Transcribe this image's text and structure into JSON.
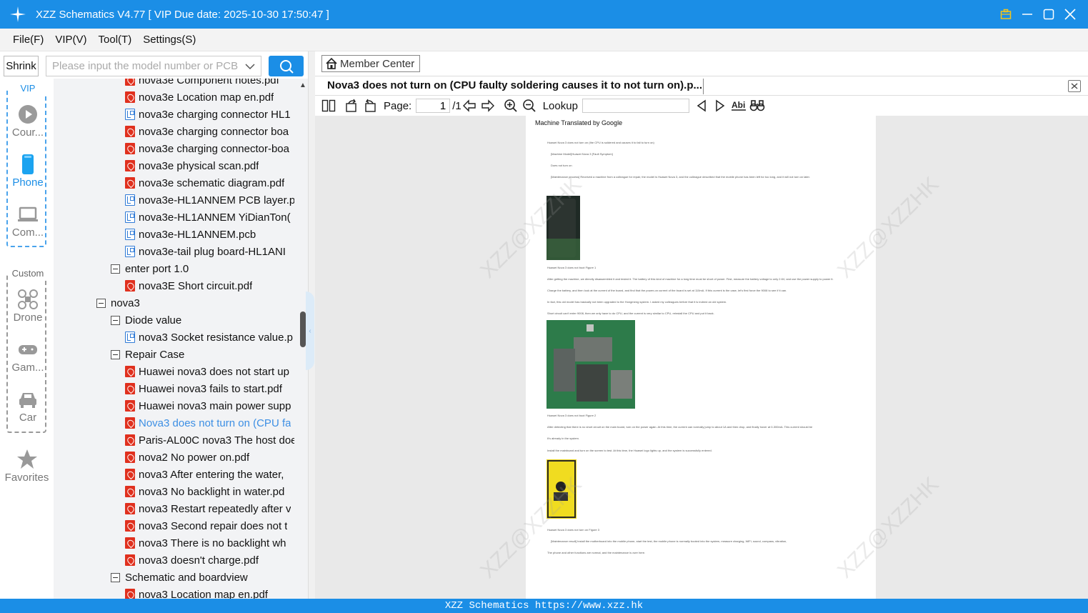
{
  "app": {
    "title": "XZZ Schematics V4.77 [ VIP Due date: 2025-10-30 17:50:47 ]"
  },
  "menu": [
    "File(F)",
    "VIP(V)",
    "Tool(T)",
    "Settings(S)"
  ],
  "search": {
    "shrink_label": "Shrink",
    "placeholder": "Please input the model number or PCB",
    "value": ""
  },
  "categories": {
    "vip_label": "VIP",
    "custom_label": "Custom",
    "items": [
      "Cour...",
      "Phone",
      "Com...",
      "Drone",
      "Gam...",
      "Car"
    ],
    "active": "Phone",
    "favorites": "Favorites"
  },
  "tree": [
    {
      "type": "pdf",
      "label": "nova3e Component notes.pdf"
    },
    {
      "type": "pdf",
      "label": "nova3e Location map en.pdf"
    },
    {
      "type": "pcb",
      "label": "nova3e charging connector HL1"
    },
    {
      "type": "pdf",
      "label": "nova3e charging connector boa"
    },
    {
      "type": "pdf",
      "label": "nova3e charging connector-boa"
    },
    {
      "type": "pdf",
      "label": "nova3e physical scan.pdf"
    },
    {
      "type": "pdf",
      "label": "nova3e schematic diagram.pdf"
    },
    {
      "type": "pcb",
      "label": "nova3e-HL1ANNEM PCB layer.p"
    },
    {
      "type": "pcb",
      "label": "nova3e-HL1ANNEM YiDianTon("
    },
    {
      "type": "pcb",
      "label": "nova3e-HL1ANNEM.pcb"
    },
    {
      "type": "pcb",
      "label": "nova3e-tail plug board-HL1ANI"
    },
    {
      "type": "folder",
      "label": "enter port 1.0"
    },
    {
      "type": "pdf",
      "label": "nova3E Short circuit.pdf"
    },
    {
      "type": "folder",
      "label": "nova3"
    },
    {
      "type": "folder",
      "label": "Diode value"
    },
    {
      "type": "pcb",
      "label": "nova3 Socket resistance value.p"
    },
    {
      "type": "folder",
      "label": "Repair Case"
    },
    {
      "type": "pdf",
      "label": "Huawei nova3 does not start up"
    },
    {
      "type": "pdf",
      "label": "Huawei nova3 fails to start.pdf"
    },
    {
      "type": "pdf",
      "label": "Huawei nova3 main power supp"
    },
    {
      "type": "pdf",
      "label": "Nova3 does not turn on (CPU fa"
    },
    {
      "type": "pdf",
      "label": "Paris-AL00C nova3 The host doe"
    },
    {
      "type": "pdf",
      "label": "nova2 No power on.pdf"
    },
    {
      "type": "pdf",
      "label": "nova3 After entering the water,"
    },
    {
      "type": "pdf",
      "label": "nova3 No backlight in water.pd"
    },
    {
      "type": "pdf",
      "label": "nova3 Restart repeatedly after v"
    },
    {
      "type": "pdf",
      "label": "nova3 Second repair does not t"
    },
    {
      "type": "pdf",
      "label": "nova3 There is no backlight wh"
    },
    {
      "type": "pdf",
      "label": "nova3 doesn't charge.pdf"
    },
    {
      "type": "folder",
      "label": "Schematic and boardview"
    },
    {
      "type": "pdf",
      "label": "nova3 Location map en.pdf"
    }
  ],
  "viewer": {
    "member_center": "Member Center",
    "doc_tab": "Nova3 does not turn on (CPU faulty soldering causes it to not turn on).p...",
    "page_label": "Page:",
    "page_value": "1",
    "page_total": "/1",
    "lookup_label": "Lookup",
    "lookup_value": "",
    "page_header": "Machine Translated by Google",
    "lines": [
      "Huawei Nova 3 does not turn on (the CPU is soldered and causes it to fail to turn on)",
      "[Machine Model]Huawei Nova 3 [Fault Symptom]",
      "Does not turn on",
      "[Maintenance process] Received a machine from a colleague for repair, the model is Huawei Nova 3, and the colleague described that the mobile phone has been left for too long, and it will not turn on later.",
      "Huawei Nova 3 does not boot Figure 1",
      "After getting the machine, we directly disassembled it and tested it. The battery of this kind of machine for a long time must be short of power. First, measure the battery voltage to only 2.6V, and use the power supply to power it.",
      "Charge the battery, and then look at the current of the board, and find that the power-on current of the board is set at 110mA. If this current is the case, let's first force the 9008 to see if it can.",
      "In fact, this old model has basically not been upgraded to the Hongmeng system. I asked my colleagues before that it is indeed an old system.",
      "Short circuit can't enter 9008, then we only have to do CPU, and the current is very similar to CPU, reinstall the CPU and put it back.",
      "Huawei Nova 3 does not boot Figure 2",
      "After detecting that there is no short circuit on the main board, turn on the power again. At this time, the current can normally jump to about 1A and then drop, and finally hover at 0-300mA. This current should be",
      "It's already in the system.",
      "Install the mainboard and turn on the screen to test. At this time, the Huawei logo lights up, and the system is successfully entered.",
      "Huawei Nova 3 does not turn on Figure 3",
      "[Maintenance result] Install the motherboard into the mobile phone, start the test, the mobile phone is normally booted into the system, measure charging, WiFi, sound, compass, vibration,",
      "The phone and other functions are normal, and the maintenance is over here."
    ],
    "watermark": "XZZ@XZZHK"
  },
  "status": "XZZ Schematics https://www.xzz.hk",
  "colors": {
    "accent": "#1b8ee6",
    "pdf": "#e0301e",
    "selected": "#3d8fe4"
  }
}
